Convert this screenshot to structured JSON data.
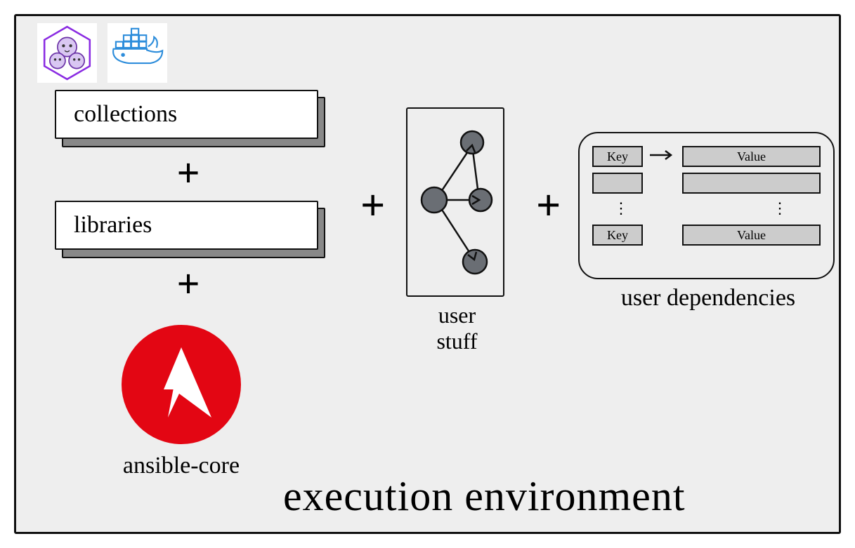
{
  "title": "execution environment",
  "icons": {
    "podman": "podman-icon",
    "docker": "docker-icon"
  },
  "left_stack": {
    "box1": "collections",
    "plus1": "+",
    "box2": "libraries",
    "plus2": "+",
    "ansible_label": "ansible-core"
  },
  "connectors": {
    "plus_a": "+",
    "plus_b": "+"
  },
  "user_stuff": {
    "label_line1": "user",
    "label_line2": "stuff"
  },
  "user_deps": {
    "label": "user dependencies",
    "rows": [
      {
        "key": "Key",
        "value": "Value",
        "arrow": true
      },
      {
        "key": "",
        "value": "",
        "arrow": false
      },
      {
        "key": "Key",
        "value": "Value",
        "arrow": false
      }
    ],
    "dots": "⋮"
  }
}
